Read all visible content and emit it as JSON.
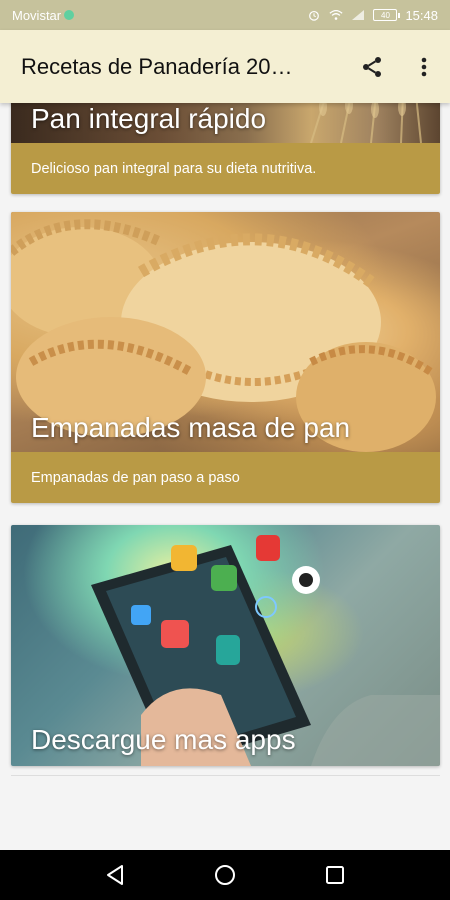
{
  "status_bar": {
    "carrier": "Movistar",
    "battery": "40",
    "time": "15:48"
  },
  "app_bar": {
    "title": "Recetas de Panadería 20…",
    "share_icon": "share-icon",
    "more_icon": "more-vert-icon"
  },
  "cards": [
    {
      "title": "Pan integral rápido",
      "description": "Delicioso pan integral para su dieta nutritiva."
    },
    {
      "title": "Empanadas masa de pan",
      "description": "Empanadas de pan paso a paso"
    },
    {
      "title": "Descargue mas apps"
    }
  ],
  "nav_bar": {
    "back_icon": "back-triangle-icon",
    "home_icon": "home-circle-icon",
    "recents_icon": "recents-square-icon"
  },
  "colors": {
    "status_bar": "#c6c29c",
    "app_bar": "#f4efd3",
    "card_description_bg": "#b99a45",
    "nav_bar": "#000000"
  }
}
